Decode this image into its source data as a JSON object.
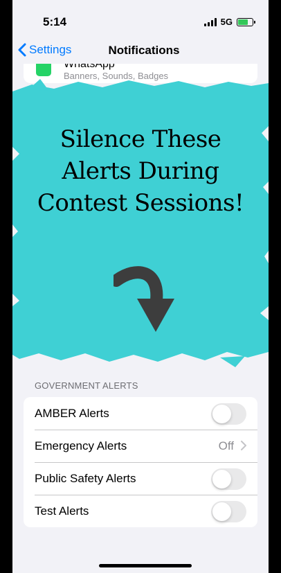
{
  "status_bar": {
    "time": "5:14",
    "network": "5G"
  },
  "nav": {
    "back_label": "Settings",
    "title": "Notifications"
  },
  "whatsapp_row": {
    "name": "WhatsApp",
    "subtitle": "Banners, Sounds, Badges"
  },
  "overlay": {
    "line1": "Silence These",
    "line2": "Alerts During",
    "line3": "Contest Sessions!",
    "splash_color": "#3fd0d4",
    "arrow_color": "#3d3d3d"
  },
  "government_alerts": {
    "header": "GOVERNMENT ALERTS",
    "items": [
      {
        "label": "AMBER Alerts",
        "control": "toggle",
        "on": false
      },
      {
        "label": "Emergency Alerts",
        "control": "disclosure",
        "value": "Off"
      },
      {
        "label": "Public Safety Alerts",
        "control": "toggle",
        "on": false
      },
      {
        "label": "Test Alerts",
        "control": "toggle",
        "on": false
      }
    ]
  }
}
